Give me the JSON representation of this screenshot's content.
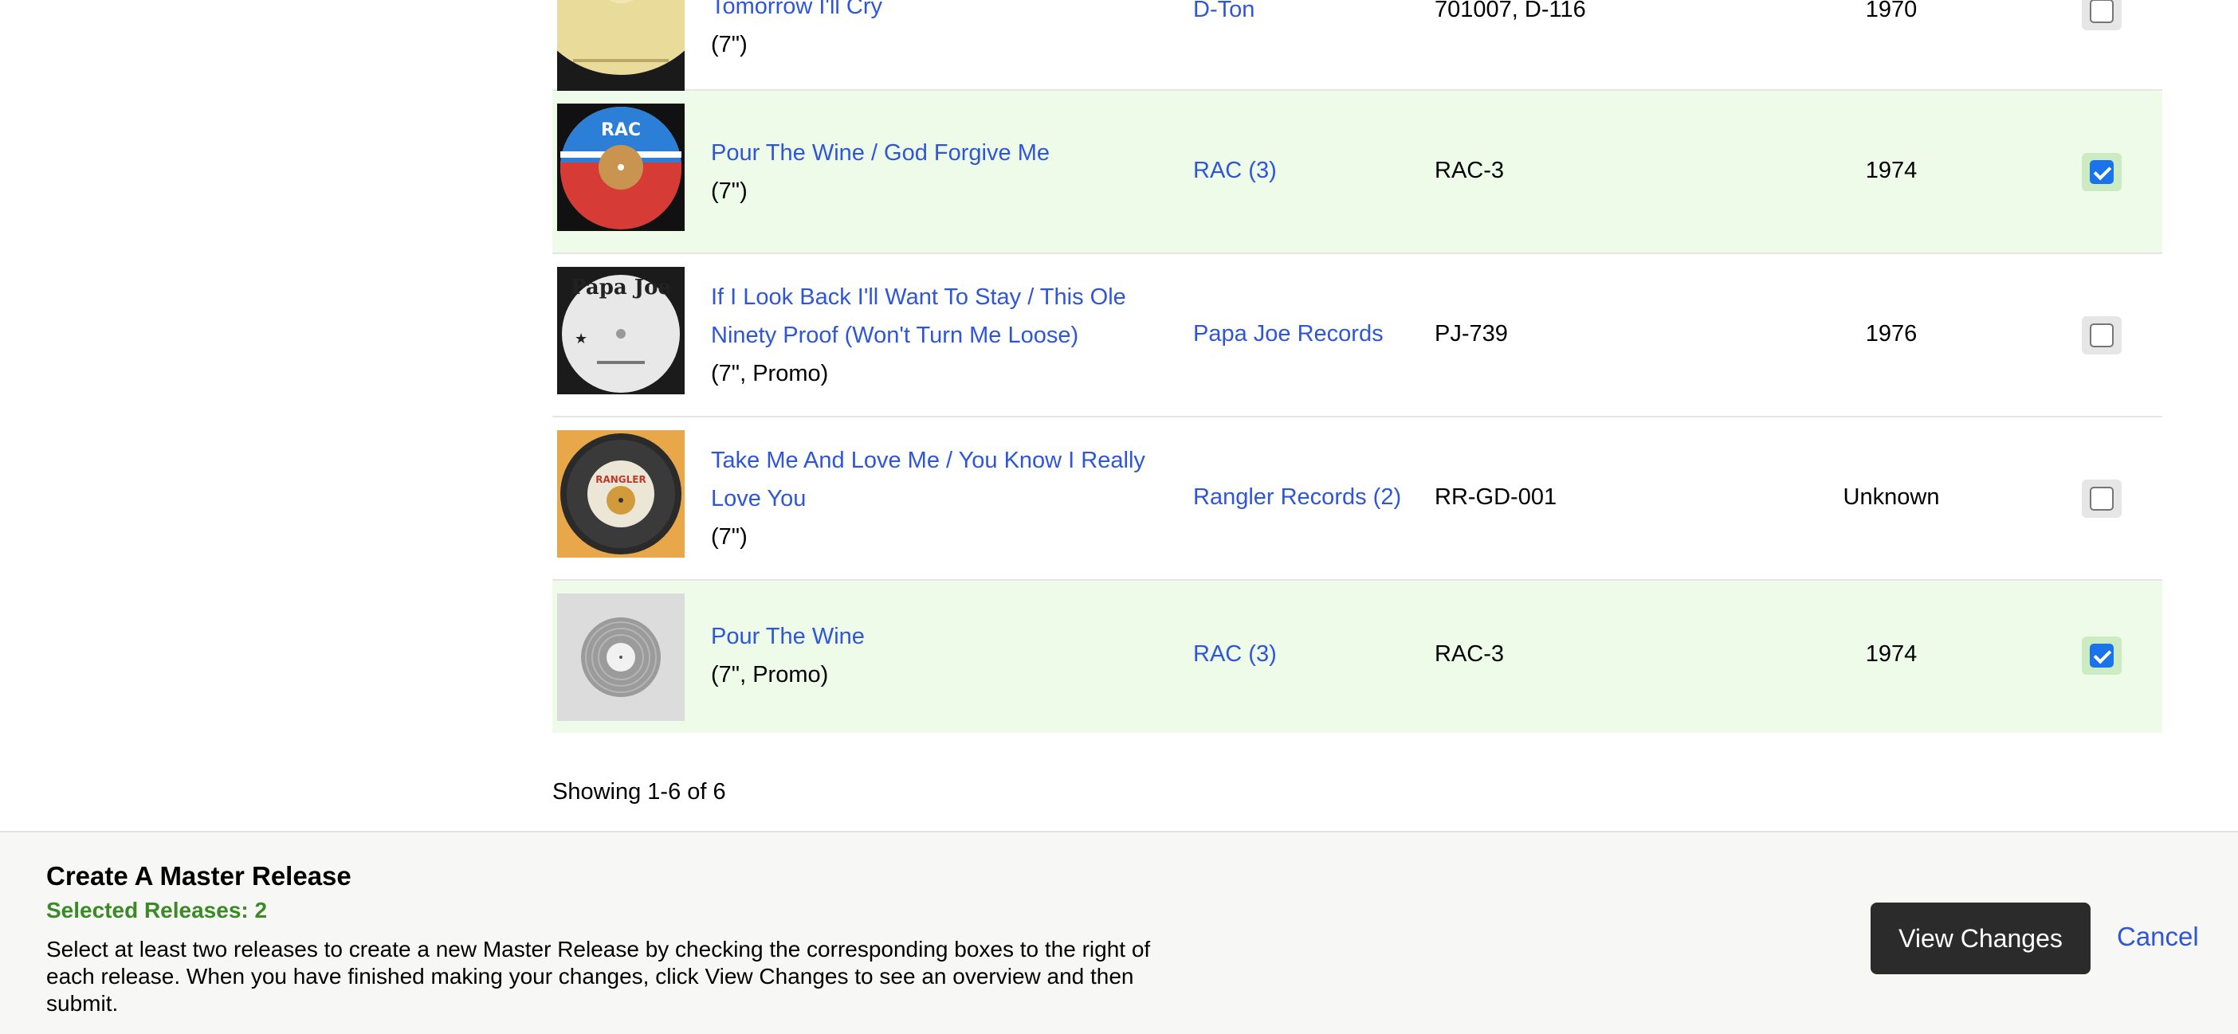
{
  "releases": [
    {
      "title": "Tomorrow I'll Cry",
      "format": "(7\")",
      "label": "D-Ton",
      "catno": "701007, D-116",
      "year": "1970",
      "selected": false
    },
    {
      "title": "Pour The Wine / God Forgive Me",
      "format": "(7\")",
      "label": "RAC (3)",
      "catno": "RAC-3",
      "year": "1974",
      "selected": true
    },
    {
      "title_line1": "If I Look Back I'll Want To Stay / This Ole",
      "title_line2": "Ninety Proof (Won't Turn Me Loose)",
      "format": "(7\", Promo)",
      "label": "Papa Joe Records",
      "catno": "PJ-739",
      "year": "1976",
      "selected": false,
      "cover_text": "Papa Joe"
    },
    {
      "title_line1": "Take Me And Love Me / You Know I Really",
      "title_line2": "Love You",
      "format": "(7\")",
      "label": "Rangler Records (2)",
      "catno": "RR-GD-001",
      "year": "Unknown",
      "selected": false,
      "cover_text": "RANGLER"
    },
    {
      "title": "Pour The Wine",
      "format": "(7\", Promo)",
      "label": "RAC (3)",
      "catno": "RAC-3",
      "year": "1974",
      "selected": true
    }
  ],
  "pagination": {
    "showing": "Showing 1-6 of 6"
  },
  "footer": {
    "title": "Create A Master Release",
    "selected_count": "Selected Releases: 2",
    "description": "Select at least two releases to create a new Master Release by checking the corresponding boxes to the right of each release. When you have finished making your changes, click View Changes to see an overview and then submit.",
    "view_changes": "View Changes",
    "cancel": "Cancel"
  },
  "colors": {
    "link": "#2e56d6",
    "selected_row": "#eefbe9",
    "accent_green": "#3a8a25",
    "button_dark": "#2b2b2b",
    "checkbox_blue": "#1a73e8"
  }
}
